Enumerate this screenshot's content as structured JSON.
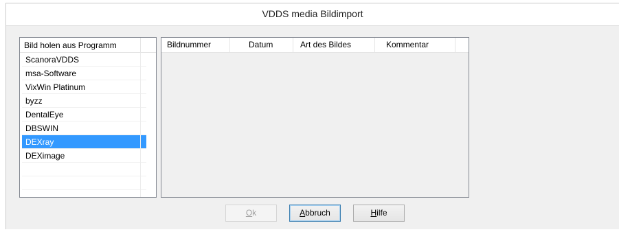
{
  "window": {
    "title": "VDDS media Bildimport"
  },
  "program_list": {
    "header": "Bild holen aus Programm",
    "items": [
      "ScanoraVDDS",
      "msa-Software",
      "VixWin Platinum",
      "byzz",
      "DentalEye",
      "DBSWIN",
      "DEXray",
      "DEXimage"
    ],
    "selected": "DEXray"
  },
  "image_table": {
    "columns": [
      "Bildnummer",
      "Datum",
      "Art des Bildes",
      "Kommentar"
    ],
    "rows": []
  },
  "buttons": {
    "ok": {
      "mnemonic": "O",
      "rest": "k",
      "enabled": false
    },
    "abbruch": {
      "mnemonic": "A",
      "rest": "bbruch",
      "enabled": true
    },
    "hilfe": {
      "mnemonic": "H",
      "rest": "ilfe",
      "enabled": true
    }
  },
  "colors": {
    "selection": "#3399ff",
    "dialog_bg": "#f0f0f0",
    "border": "#828790"
  }
}
